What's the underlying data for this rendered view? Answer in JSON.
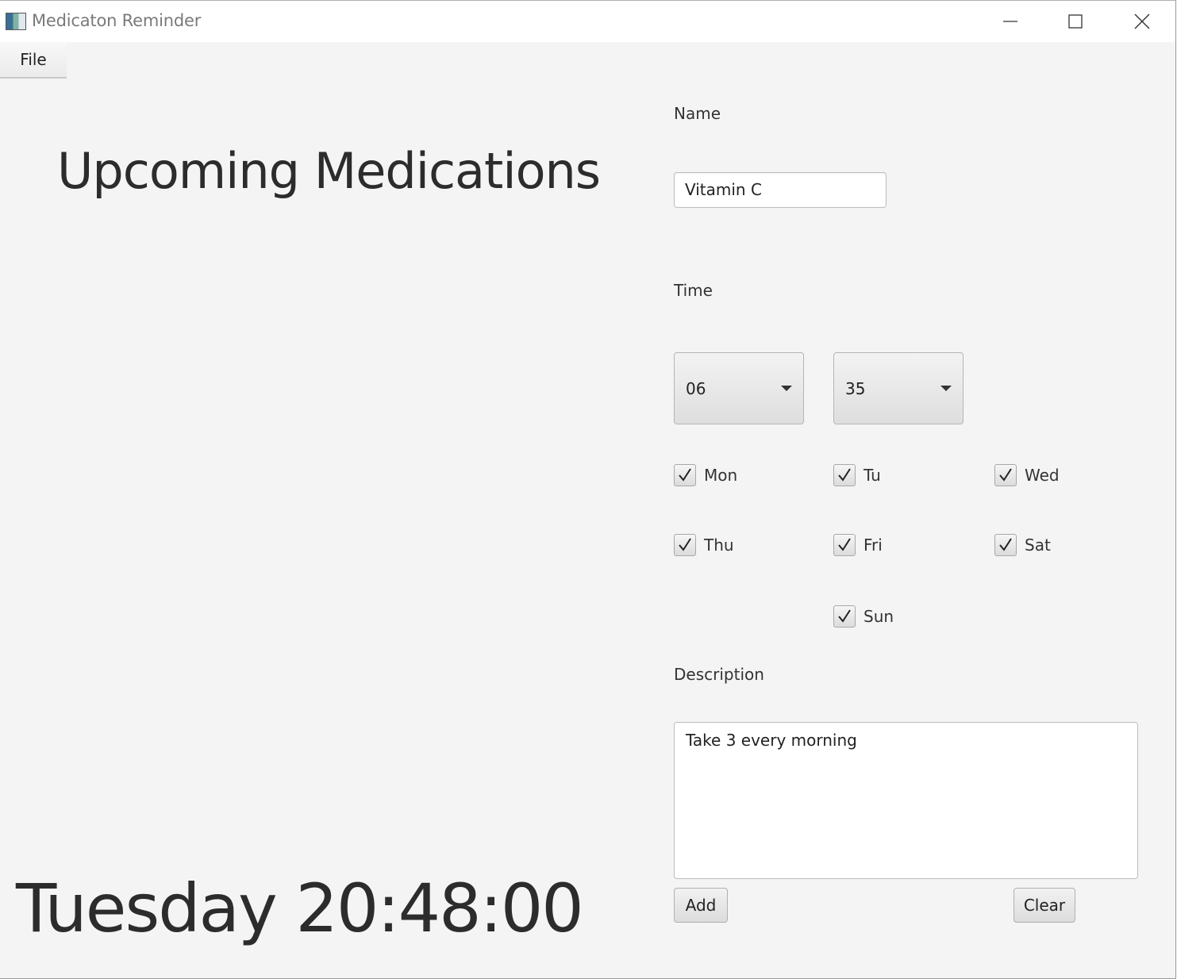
{
  "window": {
    "title": "Medicaton Reminder",
    "controls": [
      "minimize-icon",
      "maximize-icon",
      "close-icon"
    ]
  },
  "menu": {
    "file_label": "File"
  },
  "main": {
    "heading": "Upcoming Medications",
    "clock": "Tuesday 20:48:00"
  },
  "form": {
    "name_label": "Name",
    "name_value": "Vitamin C",
    "time_label": "Time",
    "hour_value": "06",
    "minute_value": "35",
    "days": [
      {
        "label": "Mon",
        "checked": true
      },
      {
        "label": "Tu",
        "checked": true
      },
      {
        "label": "Wed",
        "checked": true
      },
      {
        "label": "Thu",
        "checked": true
      },
      {
        "label": "Fri",
        "checked": true
      },
      {
        "label": "Sat",
        "checked": true
      },
      {
        "label": "Sun",
        "checked": true
      }
    ],
    "description_label": "Description",
    "description_value": "Take 3 every morning",
    "add_label": "Add",
    "clear_label": "Clear"
  }
}
